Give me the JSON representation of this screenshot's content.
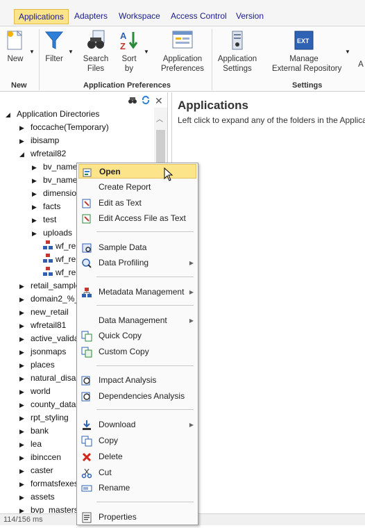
{
  "menubar": {
    "tabs": [
      "Applications",
      "Adapters",
      "Workspace",
      "Access Control",
      "Version"
    ]
  },
  "ribbon": {
    "buttons": {
      "new": "New",
      "filter": "Filter",
      "search": [
        "Search",
        "Files"
      ],
      "sort": [
        "Sort",
        "by"
      ],
      "app_prefs": [
        "Application",
        "Preferences"
      ],
      "app_settings": [
        "Application",
        "Settings"
      ],
      "manage_repo": [
        "Manage",
        "External Repository"
      ],
      "partial": "A"
    },
    "groups": {
      "new": "New",
      "app_prefs": "Application Preferences",
      "settings": "Settings"
    }
  },
  "tree": {
    "root": "Application Directories",
    "items": [
      "foccache(Temporary)",
      "ibisamp",
      "wfretail82",
      "bv_name",
      "bv_name",
      "dimensio",
      "facts",
      "test",
      "uploads",
      "wf_re",
      "wf_re",
      "wf_re",
      "retail_sample",
      "domain2_%_",
      "new_retail",
      "wfretail81",
      "active_valida",
      "jsonmaps",
      "places",
      "natural_disas",
      "world",
      "county_data",
      "rpt_styling",
      "bank",
      "lea",
      "ibinccen",
      "caster",
      "formatsfexes",
      "assets",
      "bvp_masters"
    ]
  },
  "right_panel": {
    "title": "Applications",
    "subtitle": "Left click to expand any of the folders in the Applica"
  },
  "status": {
    "text": "114/156 ms"
  },
  "context_menu": {
    "items": [
      "Open",
      "Create Report",
      "Edit as Text",
      "Edit Access File as Text",
      "Sample Data",
      "Data Profiling",
      "Metadata Management",
      "Data Management",
      "Quick Copy",
      "Custom Copy",
      "Impact Analysis",
      "Dependencies Analysis",
      "Download",
      "Copy",
      "Delete",
      "Cut",
      "Rename",
      "Properties"
    ]
  },
  "colors": {
    "accent_highlight": "#fbe48a",
    "link_blue": "#1a1a8a"
  }
}
